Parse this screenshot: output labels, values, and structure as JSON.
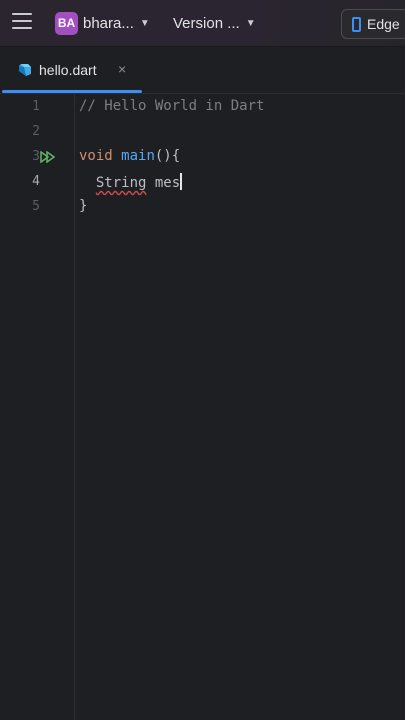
{
  "titlebar": {
    "project_initials": "BA",
    "project_name": "bhara...",
    "vcs_label": "Version ...",
    "device_label": "Edge",
    "accent": "#a24fc2"
  },
  "tabs": [
    {
      "label": "hello.dart",
      "icon": "dart-icon",
      "close": "×",
      "active": true
    }
  ],
  "editor": {
    "lines": [
      {
        "number": "1",
        "comment": "// Hello World in Dart"
      },
      {
        "number": "2"
      },
      {
        "number": "3",
        "keyword": "void",
        "function": "main",
        "rest": "(){"
      },
      {
        "number": "4",
        "type": "String",
        "text": " mes",
        "active": true
      },
      {
        "number": "5",
        "text": "}"
      }
    ]
  },
  "colors": {
    "keyword": "#cf8e6d",
    "function": "#56a8f5",
    "comment": "#7a7e85",
    "tab_underline": "#3e8ef7",
    "error_underline": "#d14b4b"
  }
}
